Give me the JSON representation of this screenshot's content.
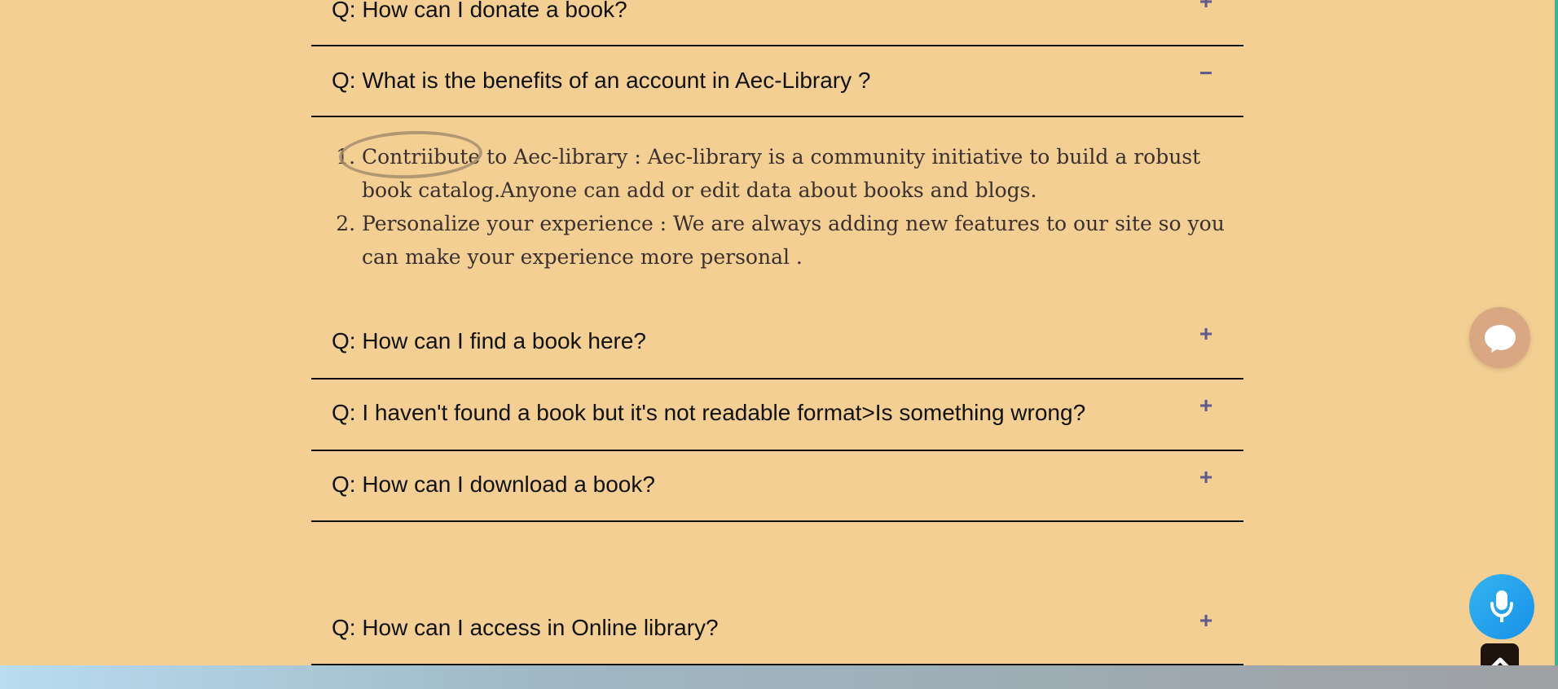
{
  "faq": {
    "items": [
      {
        "question": "Q: How can I donate a book?",
        "toggle": "+"
      },
      {
        "question": "Q: What is the benefits of an account in Aec-Library ?",
        "toggle": "−"
      },
      {
        "question": "Q: How can I find a book here?",
        "toggle": "+"
      },
      {
        "question": "Q: I haven't found a book but it's not readable format>Is something wrong?",
        "toggle": "+"
      },
      {
        "question": "Q: How can I download a book?",
        "toggle": "+"
      },
      {
        "question": "Q: How can I access in Online library?",
        "toggle": "+"
      }
    ],
    "expanded_answer": {
      "items": [
        "Contriibute to Aec-library : Aec-library is a community initiative to build a robust book catalog.Anyone can add or edit data about books and blogs.",
        "Personalize your experience : We are always adding new features to our site so you can make your experience more personal ."
      ]
    }
  },
  "widgets": {
    "chat_icon": "chat-bubble-icon",
    "mic_icon": "microphone-icon",
    "scroll_icon": "chevron-up-icon"
  },
  "colors": {
    "background": "#f3cf94",
    "toggle": "#5e5a8a",
    "chat": "#d9a782",
    "mic": "#1b9cf0"
  }
}
